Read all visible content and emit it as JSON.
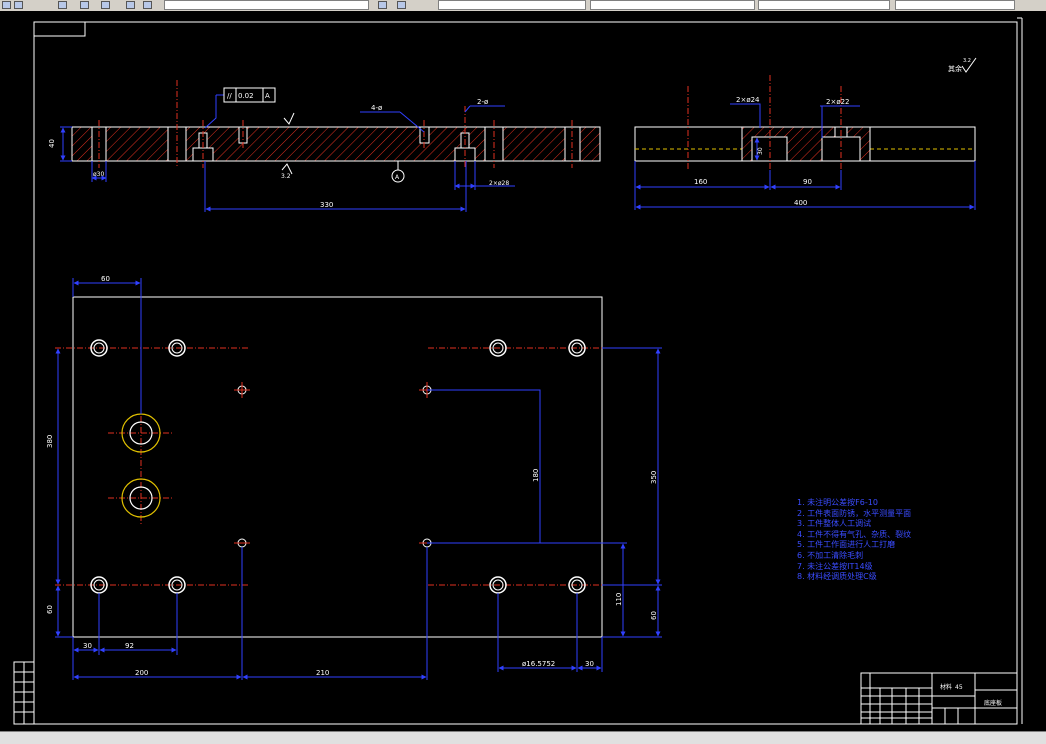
{
  "toolbar": {
    "layer_box": "",
    "style_box": "",
    "color_box": "",
    "linetype_box": "",
    "lineweight_box": ""
  },
  "surface_symbol": "其余",
  "roughness_value": "3.2",
  "tolerance_frame": {
    "symbol": "//",
    "value": "0.02",
    "datum": "A"
  },
  "section_view": {
    "thickness": "40",
    "hole_dim": "ø30",
    "length_330": "330",
    "callout_m": "4-ø",
    "callout_2m": "2-ø",
    "callout_2xm": "2×ø28",
    "datum_a": "A"
  },
  "side_view": {
    "dim_2xm1": "2×ø24",
    "dim_2xm2": "2×ø22",
    "dim_30": "30",
    "dim_160": "160",
    "dim_90": "90",
    "dim_400": "400"
  },
  "plan_view": {
    "dim_top_60": "60",
    "dim_left_380": "380",
    "dim_180": "180",
    "dim_right_350": "350",
    "dim_bottom_60": "60",
    "dim_110": "110",
    "dim_right_60": "60",
    "dim_30": "30",
    "dim_92": "92",
    "dim_200": "200",
    "dim_210": "210",
    "dim_fit": "ø16.5752",
    "dim_30b": "30"
  },
  "notes": [
    "1. 未注明公差按F6-10",
    "2. 工件表面防锈，水平测量平面",
    "3. 工件整体人工调试",
    "4. 工件不得有气孔、杂质、裂纹",
    "5. 工件工作面进行人工打磨",
    "6. 不加工清除毛刺",
    "7. 未注公差按IT14级",
    "8. 材料经调质处理C级"
  ],
  "title_block": {
    "material_label": "材料",
    "material_value": "45",
    "part_name": "底座板"
  }
}
